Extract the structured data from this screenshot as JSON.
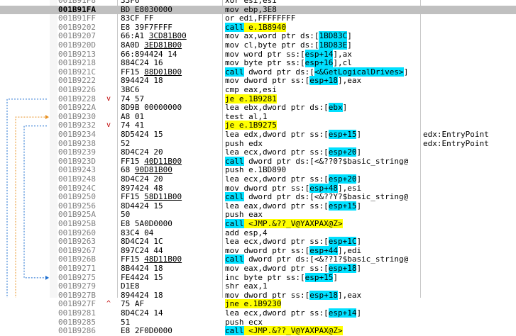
{
  "rows": [
    {
      "addr": "001B91F8",
      "bytes": "33F6",
      "instr": "xor esi,esi",
      "style": "none",
      "jmark": "",
      "comment": ""
    },
    {
      "addr": "001B91FA",
      "bytes": "BD E8030000",
      "instr": "mov ebp,3E8",
      "style": "none",
      "jmark": "",
      "comment": "",
      "selected": true
    },
    {
      "addr": "001B91FF",
      "bytes": "83CF FF",
      "instr": "or edi,FFFFFFFF",
      "style": "none",
      "jmark": "",
      "comment": ""
    },
    {
      "addr": "001B9202",
      "bytes": "E8 39F7FFFF",
      "instr": "call e.1B8940",
      "style": "call",
      "jmark": "",
      "comment": ""
    },
    {
      "addr": "001B9207",
      "bytes": "66:A1 3CD81B00",
      "instr": "mov ax,word ptr ds:[1BD83C]",
      "style": "none",
      "jmark": "",
      "comment": ""
    },
    {
      "addr": "001B920D",
      "bytes": "8A0D 3ED81B00",
      "instr": "mov cl,byte ptr ds:[1BD83E]",
      "style": "none",
      "jmark": "",
      "comment": ""
    },
    {
      "addr": "001B9213",
      "bytes": "66:894424 14",
      "instr": "mov word ptr ss:[esp+14],ax",
      "style": "none",
      "jmark": "",
      "comment": ""
    },
    {
      "addr": "001B9218",
      "bytes": "884C24 16",
      "instr": "mov byte ptr ss:[esp+16],cl",
      "style": "none",
      "jmark": "",
      "comment": ""
    },
    {
      "addr": "001B921C",
      "bytes": "FF15 88D01B00",
      "instr": "call dword ptr ds:[<&GetLogicalDrives>]",
      "style": "call",
      "jmark": "",
      "comment": ""
    },
    {
      "addr": "001B9222",
      "bytes": "894424 18",
      "instr": "mov dword ptr ss:[esp+18],eax",
      "style": "none",
      "jmark": "",
      "comment": ""
    },
    {
      "addr": "001B9226",
      "bytes": "3BC6",
      "instr": "cmp eax,esi",
      "style": "none",
      "jmark": "",
      "comment": ""
    },
    {
      "addr": "001B9228",
      "bytes": "74 57",
      "instr": "je e.1B9281",
      "style": "je",
      "jmark": "v",
      "comment": ""
    },
    {
      "addr": "001B922A",
      "bytes": "8D9B 00000000",
      "instr": "lea ebx,dword ptr ds:[ebx]",
      "style": "none",
      "jmark": "",
      "comment": ""
    },
    {
      "addr": "001B9230",
      "bytes": "A8 01",
      "instr": "test al,1",
      "style": "none",
      "jmark": "",
      "comment": ""
    },
    {
      "addr": "001B9232",
      "bytes": "74 41",
      "instr": "je e.1B9275",
      "style": "je",
      "jmark": "v",
      "comment": ""
    },
    {
      "addr": "001B9234",
      "bytes": "8D5424 15",
      "instr": "lea edx,dword ptr ss:[esp+15]",
      "style": "none",
      "jmark": "",
      "comment": "edx:EntryPoint"
    },
    {
      "addr": "001B9238",
      "bytes": "52",
      "instr": "push edx",
      "style": "none",
      "jmark": "",
      "comment": "edx:EntryPoint"
    },
    {
      "addr": "001B9239",
      "bytes": "8D4C24 20",
      "instr": "lea ecx,dword ptr ss:[esp+20]",
      "style": "none",
      "jmark": "",
      "comment": ""
    },
    {
      "addr": "001B923D",
      "bytes": "FF15 40D11B00",
      "instr": "call dword ptr ds:[<&??0?$basic_string@",
      "style": "call",
      "jmark": "",
      "comment": ""
    },
    {
      "addr": "001B9243",
      "bytes": "68 90D81B00",
      "instr": "push e.1BD890",
      "style": "none",
      "jmark": "",
      "comment": ""
    },
    {
      "addr": "001B9248",
      "bytes": "8D4C24 20",
      "instr": "lea ecx,dword ptr ss:[esp+20]",
      "style": "none",
      "jmark": "",
      "comment": ""
    },
    {
      "addr": "001B924C",
      "bytes": "897424 48",
      "instr": "mov dword ptr ss:[esp+48],esi",
      "style": "none",
      "jmark": "",
      "comment": ""
    },
    {
      "addr": "001B9250",
      "bytes": "FF15 58D11B00",
      "instr": "call dword ptr ds:[<&??Y?$basic_string@",
      "style": "call",
      "jmark": "",
      "comment": ""
    },
    {
      "addr": "001B9256",
      "bytes": "8D4424 15",
      "instr": "lea eax,dword ptr ss:[esp+15]",
      "style": "none",
      "jmark": "",
      "comment": ""
    },
    {
      "addr": "001B925A",
      "bytes": "50",
      "instr": "push eax",
      "style": "none",
      "jmark": "",
      "comment": ""
    },
    {
      "addr": "001B925B",
      "bytes": "E8 5A0D0000",
      "instr": "call <JMP.&??_V@YAXPAX@Z>",
      "style": "call",
      "jmark": "",
      "comment": ""
    },
    {
      "addr": "001B9260",
      "bytes": "83C4 04",
      "instr": "add esp,4",
      "style": "none",
      "jmark": "",
      "comment": ""
    },
    {
      "addr": "001B9263",
      "bytes": "8D4C24 1C",
      "instr": "lea ecx,dword ptr ss:[esp+1C]",
      "style": "none",
      "jmark": "",
      "comment": ""
    },
    {
      "addr": "001B9267",
      "bytes": "897C24 44",
      "instr": "mov dword ptr ss:[esp+44],edi",
      "style": "none",
      "jmark": "",
      "comment": ""
    },
    {
      "addr": "001B926B",
      "bytes": "FF15 48D11B00",
      "instr": "call dword ptr ds:[<&??1?$basic_string@",
      "style": "call",
      "jmark": "",
      "comment": ""
    },
    {
      "addr": "001B9271",
      "bytes": "8B4424 18",
      "instr": "mov eax,dword ptr ss:[esp+18]",
      "style": "none",
      "jmark": "",
      "comment": ""
    },
    {
      "addr": "001B9275",
      "bytes": "FE4424 15",
      "instr": "inc byte ptr ss:[esp+15]",
      "style": "none",
      "jmark": "",
      "comment": ""
    },
    {
      "addr": "001B9279",
      "bytes": "D1E8",
      "instr": "shr eax,1",
      "style": "none",
      "jmark": "",
      "comment": ""
    },
    {
      "addr": "001B927B",
      "bytes": "894424 18",
      "instr": "mov dword ptr ss:[esp+18],eax",
      "style": "none",
      "jmark": "",
      "comment": ""
    },
    {
      "addr": "001B927F",
      "bytes": "75 AF",
      "instr": "jne e.1B9230",
      "style": "je",
      "jmark": "^",
      "comment": ""
    },
    {
      "addr": "001B9281",
      "bytes": "8D4C24 14",
      "instr": "lea ecx,dword ptr ss:[esp+14]",
      "style": "none",
      "jmark": "",
      "comment": ""
    },
    {
      "addr": "001B9285",
      "bytes": "51",
      "instr": "push ecx",
      "style": "none",
      "jmark": "",
      "comment": ""
    },
    {
      "addr": "001B9286",
      "bytes": "E8 2F0D0000",
      "instr": "call <JMP.&??_V@YAXPAX@Z>",
      "style": "call",
      "jmark": "",
      "comment": ""
    }
  ],
  "colors": {
    "call": "#00e0ff",
    "jump": "#ffff00",
    "jumpmark": "#c00000",
    "arrow_taken": "#1e6fd0",
    "arrow_other": "#e89020",
    "selection": "#c0c0c0"
  }
}
